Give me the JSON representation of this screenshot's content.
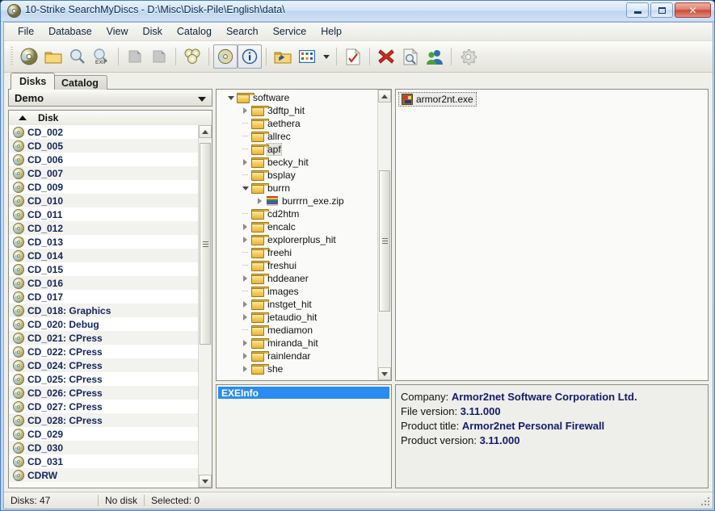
{
  "window": {
    "title": "10-Strike SearchMyDiscs - D:\\Misc\\Disk-Pile\\English\\data\\",
    "app_icon": "cd-disc-icon",
    "buttons": {
      "minimize": "minimize-button",
      "maximize": "maximize-button",
      "close": "✕"
    }
  },
  "menu": {
    "items": [
      {
        "label": "File"
      },
      {
        "label": "Database"
      },
      {
        "label": "View"
      },
      {
        "label": "Disk"
      },
      {
        "label": "Catalog"
      },
      {
        "label": "Search"
      },
      {
        "label": "Service"
      },
      {
        "label": "Help"
      }
    ]
  },
  "toolbar": {
    "buttons": [
      {
        "name": "scan-disk-icon",
        "glyph": "cd"
      },
      {
        "name": "open-folder-icon",
        "glyph": "folder"
      },
      {
        "name": "search-icon",
        "glyph": "magnifier"
      },
      {
        "name": "search-exif-icon",
        "glyph": "magnifier-exif",
        "caption": "EXIF"
      },
      {
        "name": "cut-icon",
        "glyph": "page-gray"
      },
      {
        "name": "copy-icon",
        "glyph": "page-gray2"
      },
      {
        "name": "disc-collection-icon",
        "glyph": "discs"
      },
      {
        "name": "disk-properties-icon",
        "glyph": "cd",
        "pressed": true
      },
      {
        "name": "info-icon",
        "glyph": "info",
        "pressed": true
      },
      {
        "name": "up-folder-icon",
        "glyph": "folder-up"
      },
      {
        "name": "view-mode-icon",
        "glyph": "grid"
      },
      {
        "name": "view-mode-dropdown-icon",
        "glyph": "caret"
      },
      {
        "name": "check-file-icon",
        "glyph": "page-check"
      },
      {
        "name": "delete-icon",
        "glyph": "red-x"
      },
      {
        "name": "preview-icon",
        "glyph": "page-magnifier"
      },
      {
        "name": "users-icon",
        "glyph": "users"
      },
      {
        "name": "settings-icon",
        "glyph": "gear"
      }
    ]
  },
  "tabs": [
    {
      "label": "Disks",
      "active": true
    },
    {
      "label": "Catalog",
      "active": false
    }
  ],
  "catalog_selector": {
    "value": "Demo"
  },
  "disk_list": {
    "column_header": "Disk",
    "sort": "ascending",
    "rows": [
      {
        "label": "CD_002"
      },
      {
        "label": "CD_005"
      },
      {
        "label": "CD_006"
      },
      {
        "label": "CD_007"
      },
      {
        "label": "CD_009"
      },
      {
        "label": "CD_010"
      },
      {
        "label": "CD_011"
      },
      {
        "label": "CD_012"
      },
      {
        "label": "CD_013"
      },
      {
        "label": "CD_014"
      },
      {
        "label": "CD_015"
      },
      {
        "label": "CD_016"
      },
      {
        "label": "CD_017"
      },
      {
        "label": "CD_018: Graphics"
      },
      {
        "label": "CD_020: Debug"
      },
      {
        "label": "CD_021: CPress"
      },
      {
        "label": "CD_022: CPress"
      },
      {
        "label": "CD_024: CPress"
      },
      {
        "label": "CD_025: CPress"
      },
      {
        "label": "CD_026: CPress"
      },
      {
        "label": "CD_027: CPress"
      },
      {
        "label": "CD_028: CPress"
      },
      {
        "label": "CD_029"
      },
      {
        "label": "CD_030"
      },
      {
        "label": "CD_031"
      },
      {
        "label": "CDRW"
      }
    ]
  },
  "folder_tree": {
    "nodes": [
      {
        "label": "software",
        "depth": 0,
        "state": "expanded",
        "icon": "folder-icon",
        "selected": false
      },
      {
        "label": "3dftp_hit",
        "depth": 1,
        "state": "collapsed",
        "icon": "folder-icon",
        "selected": false
      },
      {
        "label": "aethera",
        "depth": 1,
        "state": "leaf",
        "icon": "folder-icon",
        "selected": false
      },
      {
        "label": "allrec",
        "depth": 1,
        "state": "leaf",
        "icon": "folder-icon",
        "selected": false
      },
      {
        "label": "apf",
        "depth": 1,
        "state": "leaf",
        "icon": "folder-icon",
        "selected": true
      },
      {
        "label": "becky_hit",
        "depth": 1,
        "state": "collapsed",
        "icon": "folder-icon",
        "selected": false
      },
      {
        "label": "bsplay",
        "depth": 1,
        "state": "leaf",
        "icon": "folder-icon",
        "selected": false
      },
      {
        "label": "burrn",
        "depth": 1,
        "state": "expanded",
        "icon": "folder-icon",
        "selected": false
      },
      {
        "label": "burrrn_exe.zip",
        "depth": 2,
        "state": "collapsed",
        "icon": "zip-archive-icon",
        "selected": false
      },
      {
        "label": "cd2htm",
        "depth": 1,
        "state": "leaf",
        "icon": "folder-icon",
        "selected": false
      },
      {
        "label": "encalc",
        "depth": 1,
        "state": "collapsed",
        "icon": "folder-icon",
        "selected": false
      },
      {
        "label": "explorerplus_hit",
        "depth": 1,
        "state": "collapsed",
        "icon": "folder-icon",
        "selected": false
      },
      {
        "label": "freehi",
        "depth": 1,
        "state": "leaf",
        "icon": "folder-icon",
        "selected": false
      },
      {
        "label": "freshui",
        "depth": 1,
        "state": "leaf",
        "icon": "folder-icon",
        "selected": false
      },
      {
        "label": "hddeaner",
        "depth": 1,
        "state": "collapsed",
        "icon": "folder-icon",
        "selected": false
      },
      {
        "label": "images",
        "depth": 1,
        "state": "leaf",
        "icon": "folder-icon",
        "selected": false
      },
      {
        "label": "instget_hit",
        "depth": 1,
        "state": "collapsed",
        "icon": "folder-icon",
        "selected": false
      },
      {
        "label": "jetaudio_hit",
        "depth": 1,
        "state": "collapsed",
        "icon": "folder-icon",
        "selected": false
      },
      {
        "label": "mediamon",
        "depth": 1,
        "state": "leaf",
        "icon": "folder-icon",
        "selected": false
      },
      {
        "label": "miranda_hit",
        "depth": 1,
        "state": "collapsed",
        "icon": "folder-icon",
        "selected": false
      },
      {
        "label": "rainlendar",
        "depth": 1,
        "state": "collapsed",
        "icon": "folder-icon",
        "selected": false
      },
      {
        "label": "she",
        "depth": 1,
        "state": "collapsed",
        "icon": "folder-icon",
        "selected": false
      }
    ]
  },
  "info_list": {
    "items": [
      {
        "label": "EXEInfo",
        "selected": true
      }
    ]
  },
  "file_list": {
    "items": [
      {
        "label": "armor2nt.exe",
        "icon": "exe-file-icon",
        "selected": true
      }
    ]
  },
  "details": {
    "lines": [
      {
        "label": "Company:",
        "value": "Armor2net Software Corporation Ltd."
      },
      {
        "label": "File version:",
        "value": "3.11.000"
      },
      {
        "label": "Product title:",
        "value": "Armor2net Personal Firewall"
      },
      {
        "label": "Product version:",
        "value": "3.11.000"
      }
    ]
  },
  "statusbar": {
    "cells": [
      "Disks: 47",
      "No disk",
      "Selected: 0"
    ]
  },
  "colors": {
    "accent_blue": "#2a8cf0",
    "value_text": "#141a6e",
    "disk_text": "#14255c",
    "title_text": "#0b2a52"
  }
}
